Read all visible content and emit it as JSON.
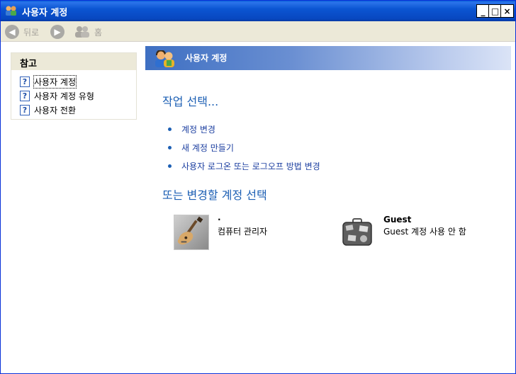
{
  "window": {
    "title": "사용자 계정",
    "minimize": "_",
    "maximize": "□",
    "close": "×"
  },
  "toolbar": {
    "back_label": "뒤로",
    "home_label": "홈"
  },
  "sidebar": {
    "heading": "참고",
    "items": [
      {
        "label": "사용자 계정"
      },
      {
        "label": "사용자 계정 유형"
      },
      {
        "label": "사용자 전환"
      }
    ]
  },
  "banner": {
    "title": "사용자 계정"
  },
  "main": {
    "pick_task_heading": "작업 선택...",
    "tasks": [
      {
        "label": "계정 변경"
      },
      {
        "label": "새 계정 만들기"
      },
      {
        "label": "사용자 로그온 또는 로그오프 방법 변경"
      }
    ],
    "pick_account_heading": "또는 변경할 계정 선택",
    "accounts": [
      {
        "name": "·",
        "description": "컴퓨터 관리자",
        "picture": "guitar-icon"
      },
      {
        "name": "Guest",
        "description": "Guest 계정 사용 안 함",
        "picture": "suitcase-icon"
      }
    ]
  },
  "colors": {
    "title_bar": "#0b55d2",
    "heading": "#1c5fb4",
    "link": "#1c3fa0"
  }
}
